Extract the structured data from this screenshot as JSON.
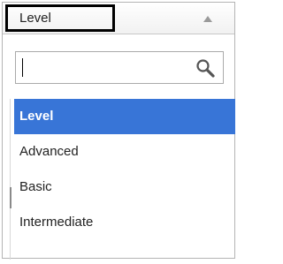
{
  "select": {
    "selected_label": "Level",
    "arrow_icon": "chevron-up-icon"
  },
  "search": {
    "value": "",
    "icon": "search-icon"
  },
  "options": [
    {
      "label": "Level",
      "highlighted": true
    },
    {
      "label": "Advanced",
      "highlighted": false
    },
    {
      "label": "Basic",
      "highlighted": false
    },
    {
      "label": "Intermediate",
      "highlighted": false
    }
  ],
  "colors": {
    "highlight": "#3875d7",
    "border": "#b4b4b4",
    "focus_outline": "#000000"
  }
}
